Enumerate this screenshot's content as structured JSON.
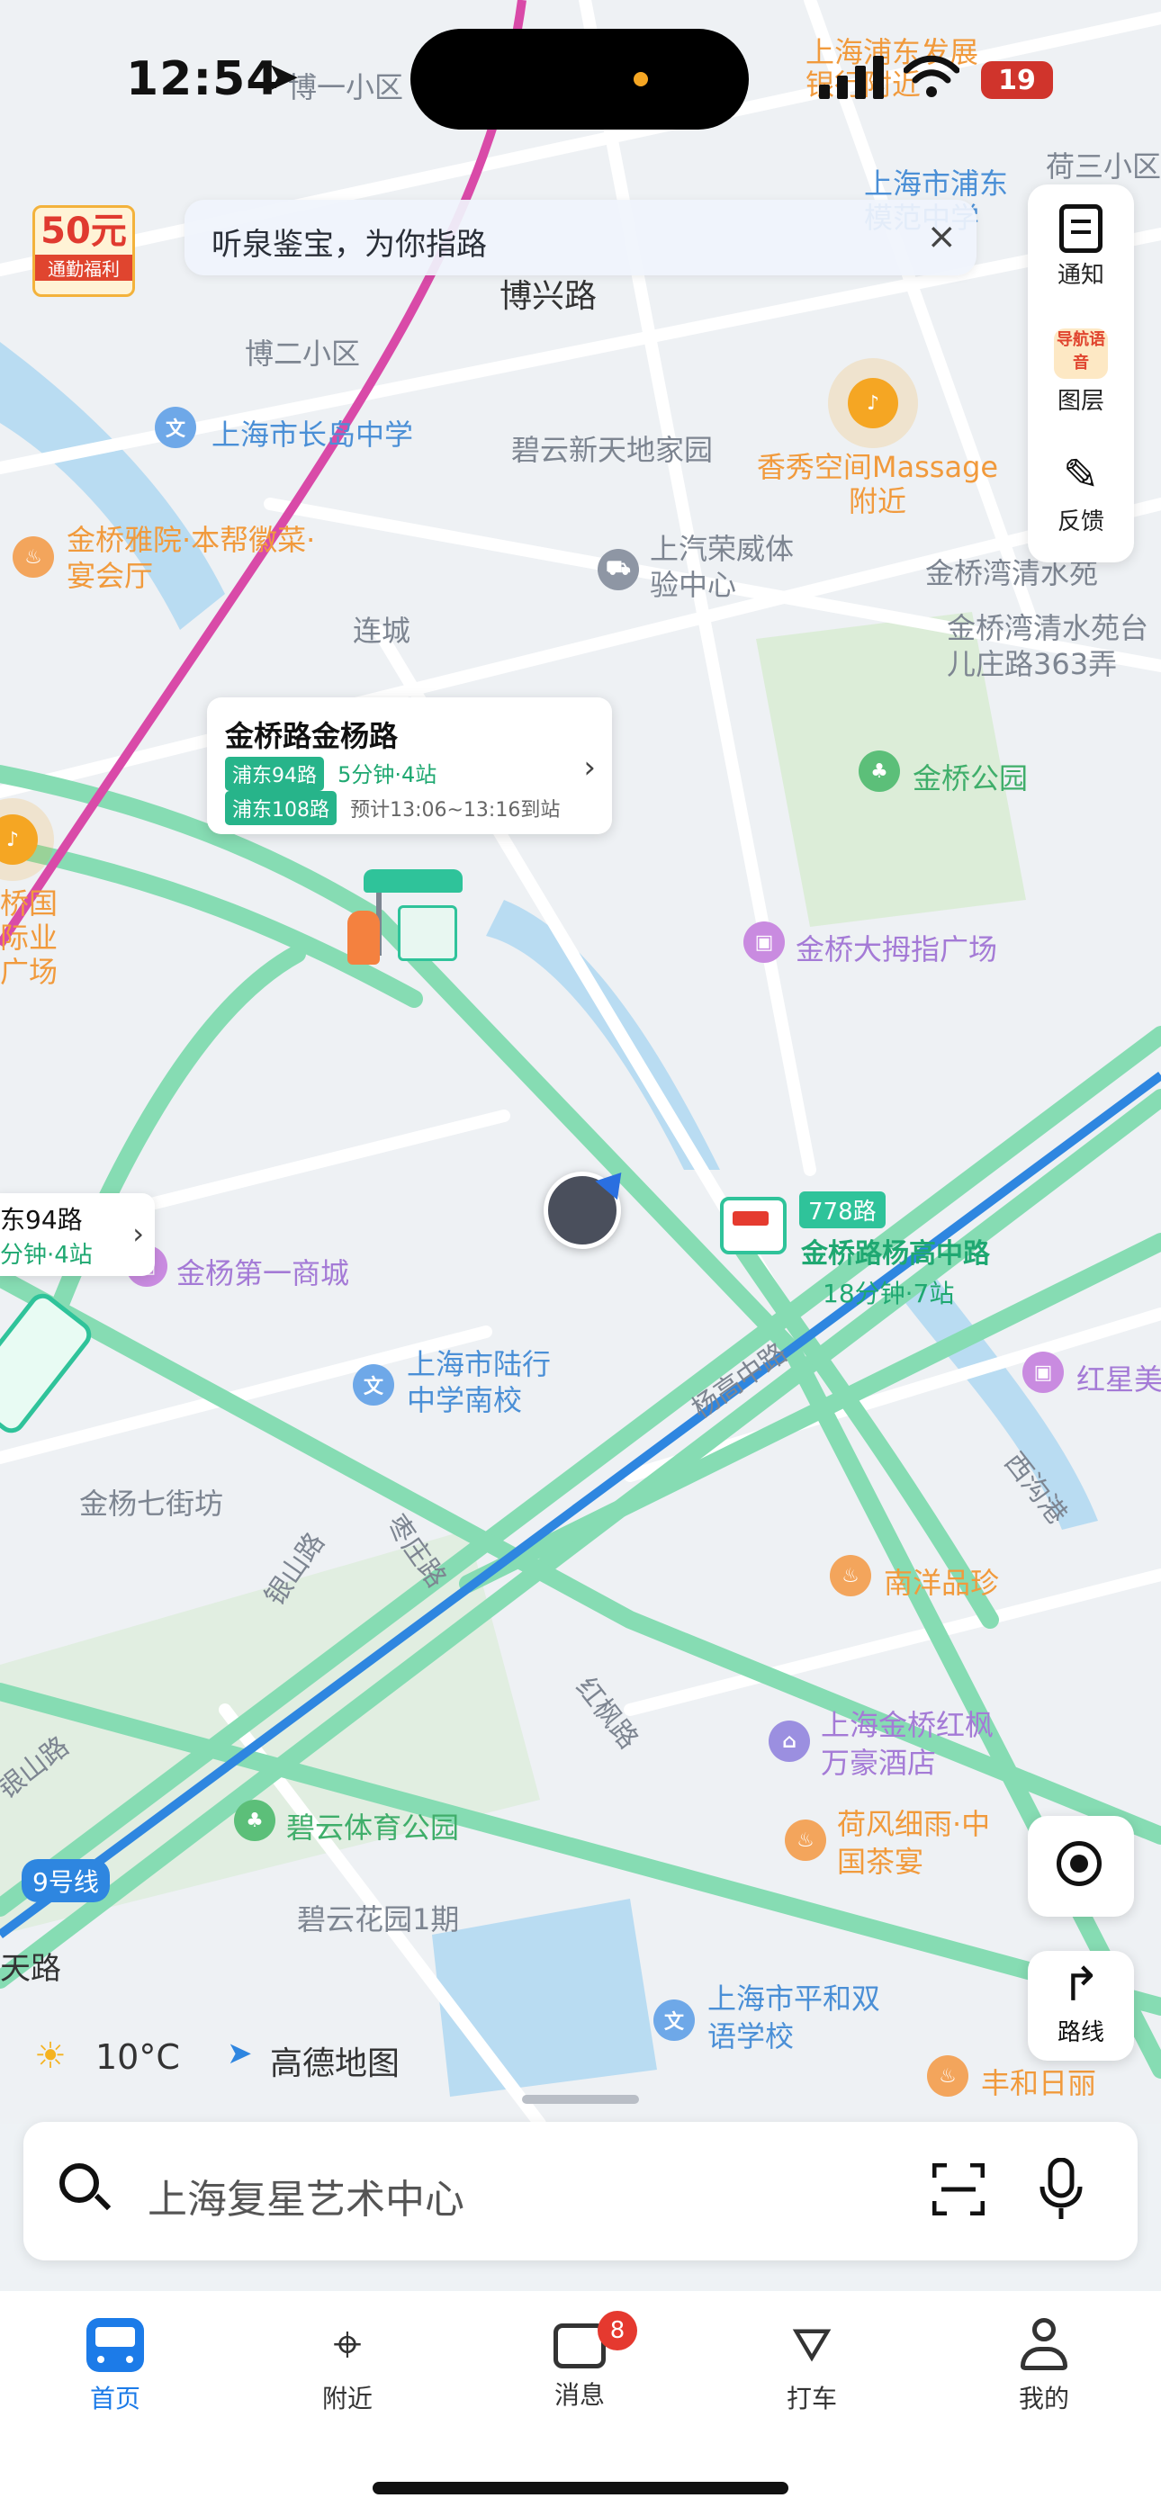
{
  "status_bar": {
    "time": "12:54",
    "battery": "19"
  },
  "banner": {
    "text": "听泉鉴宝，为你指路",
    "close": "×"
  },
  "promo_badge": {
    "amount": "50元",
    "caption": "通勤福利"
  },
  "tools": [
    {
      "label": "通知"
    },
    {
      "label": "图层",
      "badge": "导航语音"
    },
    {
      "label": "反馈"
    }
  ],
  "map": {
    "labels": {
      "top_orange": "上海浦东发展银行附近",
      "boyi": "博一小区",
      "hesan": "荷三小区",
      "pudong_school": "上海市浦东模范中学",
      "boxing_road": "博兴路",
      "boer": "博二小区",
      "changdao": "上海市长岛中学",
      "biyun_home": "碧云新天地家园",
      "xiangxiu": "香秀空间Massage附近",
      "jinqiao_yayuan": "金桥雅院·本帮徽菜·宴会厅",
      "shangqi": "上汽荣威体验中心",
      "jinqiaowan": "金桥湾清水苑",
      "lianlcheng": "连城",
      "jinqiaowan_2": "金桥湾清水苑台儿庄路363弄",
      "jinqiao_park": "金桥公园",
      "jinqiao_intl": "桥国际业广场",
      "jinqiao_mall": "金桥大拇指广场",
      "jinyang_mall": "金杨第一商城",
      "luhang_school": "上海市陆行中学南校",
      "hongxing": "红星美",
      "jinyang7": "金杨七街坊",
      "xigou": "西沟港",
      "nanyang": "南洋品珍",
      "yinshan_road": "银山路",
      "zaozhuang_road": "枣庄路",
      "yanggao_road": "杨高中路",
      "hongfeng_road": "红枫路",
      "marriott": "上海金桥红枫万豪酒店",
      "yinshan_road2": "银山路",
      "biyun_park": "碧云体育公园",
      "hefeng": "荷风细雨·中国茶宴",
      "biyun_garden": "碧云花园1期",
      "line9": "9号线",
      "tianlu": "天路",
      "pinghe": "上海市平和双语学校",
      "fengheri": "丰和日丽",
      "weather": "10°C",
      "amap": "高德地图"
    },
    "callout": {
      "title": "金桥路金杨路",
      "route1": "浦东94路",
      "route1_eta": "5分钟·4站",
      "route2": "浦东108路",
      "route2_eta": "预计13:06~13:16到站"
    },
    "left_callout": {
      "route": "东94路",
      "eta": "分钟·4站"
    },
    "stop2": {
      "route": "778路",
      "name": "金桥路杨高中路",
      "eta": "18分钟·7站"
    }
  },
  "locate_button": {},
  "route_button": {
    "label": "路线"
  },
  "search": {
    "placeholder": "上海复星艺术中心"
  },
  "tabs": [
    {
      "label": "首页",
      "active": true
    },
    {
      "label": "附近"
    },
    {
      "label": "消息",
      "badge": "8"
    },
    {
      "label": "打车"
    },
    {
      "label": "我的"
    }
  ],
  "colors": {
    "accent": "#1c7be8",
    "route_green": "#7fd9ae",
    "metro_blue": "#2e86e0",
    "metro_pink": "#d94aa8"
  }
}
